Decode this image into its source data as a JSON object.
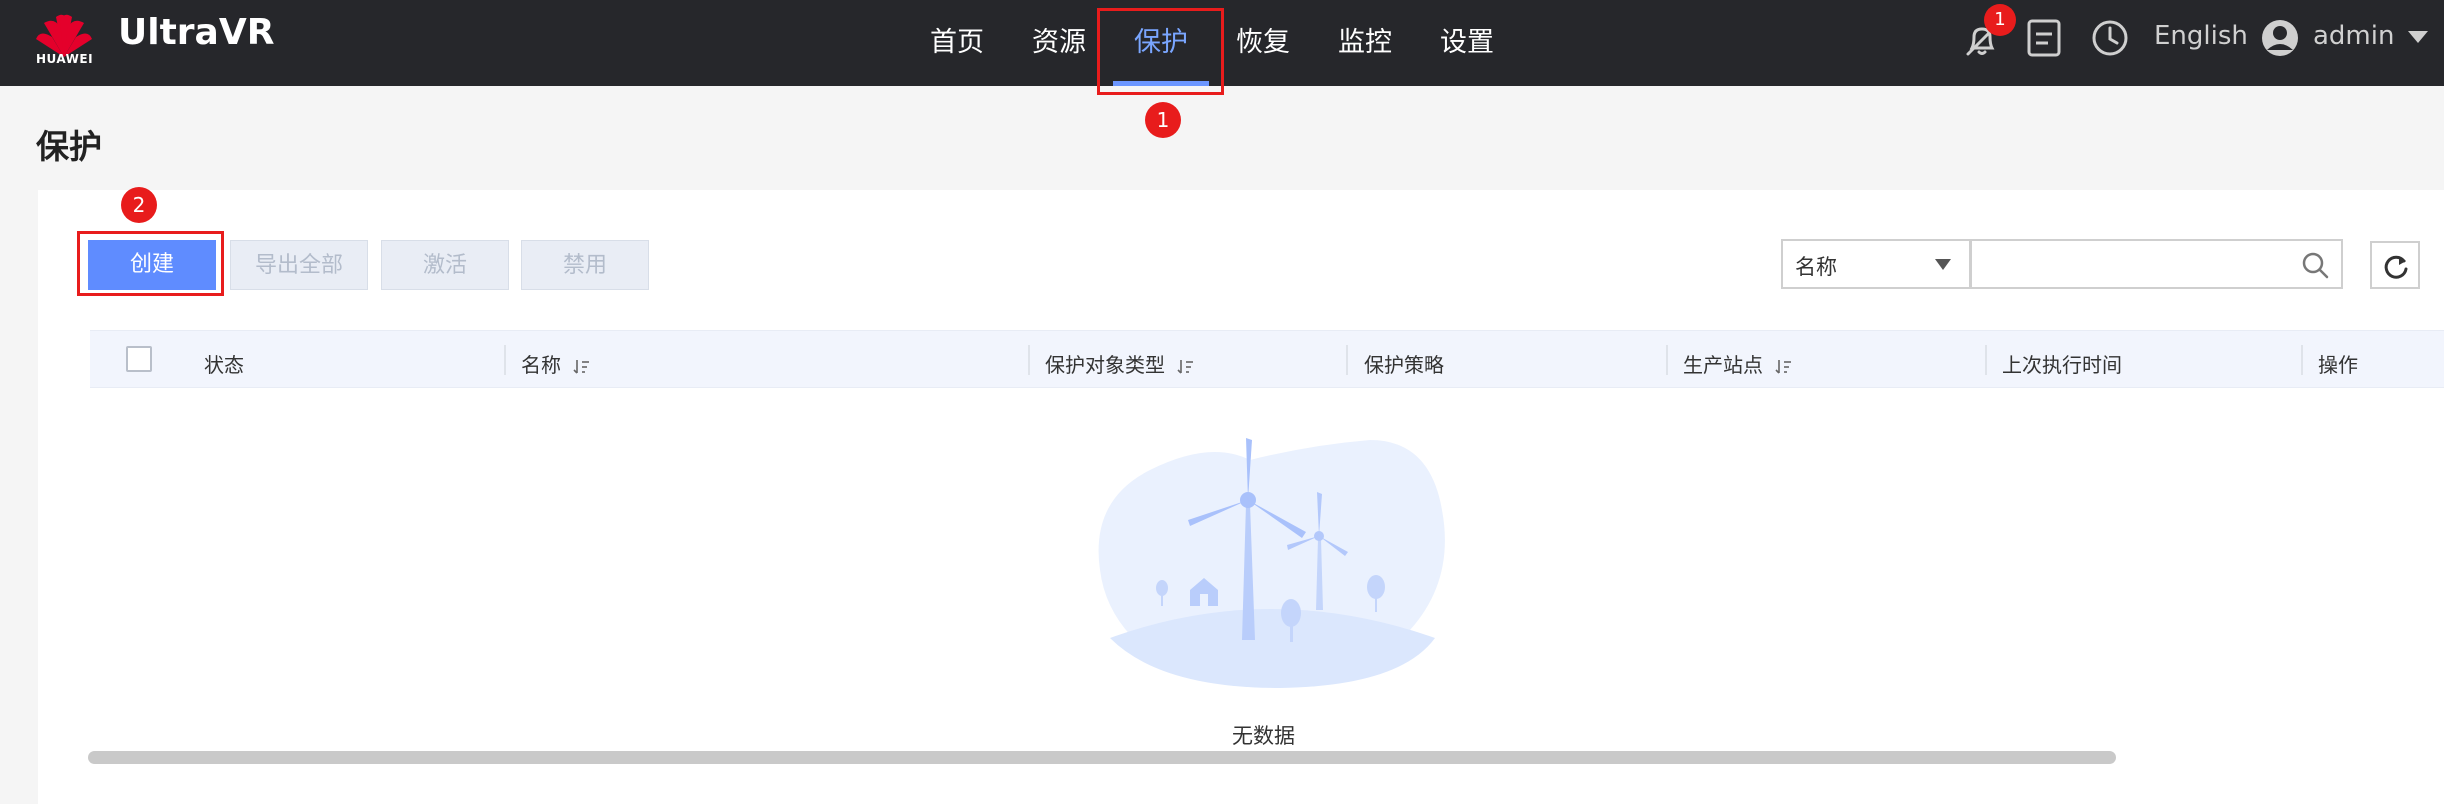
{
  "header": {
    "logo_text": "HUAWEI",
    "brand": "UltraVR",
    "nav": [
      {
        "label": "首页"
      },
      {
        "label": "资源"
      },
      {
        "label": "保护",
        "active": true
      },
      {
        "label": "恢复"
      },
      {
        "label": "监控"
      },
      {
        "label": "设置"
      }
    ],
    "notification_count": "1",
    "language": "English",
    "user": "admin"
  },
  "callouts": [
    "1",
    "2"
  ],
  "page": {
    "title": "保护"
  },
  "toolbar": {
    "create": "创建",
    "export_all": "导出全部",
    "activate": "激活",
    "disable": "禁用",
    "filter_select": "名称",
    "search_value": ""
  },
  "table": {
    "columns": [
      "状态",
      "名称",
      "保护对象类型",
      "保护策略",
      "生产站点",
      "上次执行时间",
      "操作"
    ]
  },
  "empty_state": {
    "text": "无数据"
  },
  "colors": {
    "topbar": "#26272b",
    "accent": "#5f8cff",
    "callout": "#e81c1c"
  }
}
